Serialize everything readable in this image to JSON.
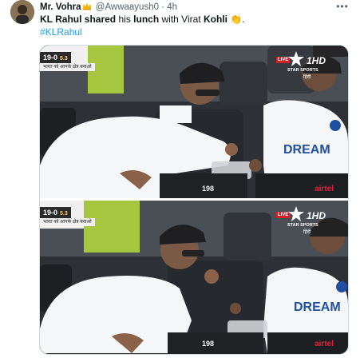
{
  "tweet": {
    "author_name": "Mr. Vohra",
    "author_handle": "@Awwaayush0",
    "separator": "·",
    "time": "4h",
    "more_label": "•••",
    "text_parts": [
      "KL Rahul shared",
      " his ",
      "lunch",
      " with Virat ",
      "Kohli",
      " 👏",
      "."
    ],
    "hashtag": "#KLRahul"
  },
  "media": {
    "frames": [
      {
        "score": "19-0",
        "over": "5.3",
        "ticker": "भारत को आपके क्षेत्र बनाओ",
        "live": "LIVE",
        "channel": "1HD",
        "network": "STAR SPORTS",
        "language": "हिंदी",
        "seat_number": "198",
        "sponsor": "airtel"
      },
      {
        "score": "19-0",
        "over": "5.3",
        "ticker": "भारत को आपके क्षेत्र बनाओ",
        "live": "LIVE",
        "channel": "1HD",
        "network": "STAR SPORTS",
        "language": "हिंदी",
        "seat_number": "198",
        "sponsor": "airtel"
      }
    ],
    "jersey_text": "DREAM"
  },
  "colors": {
    "accent": "#1d9bf0",
    "verified": "#f7b500",
    "jersey_text": "#1e4fa0"
  }
}
